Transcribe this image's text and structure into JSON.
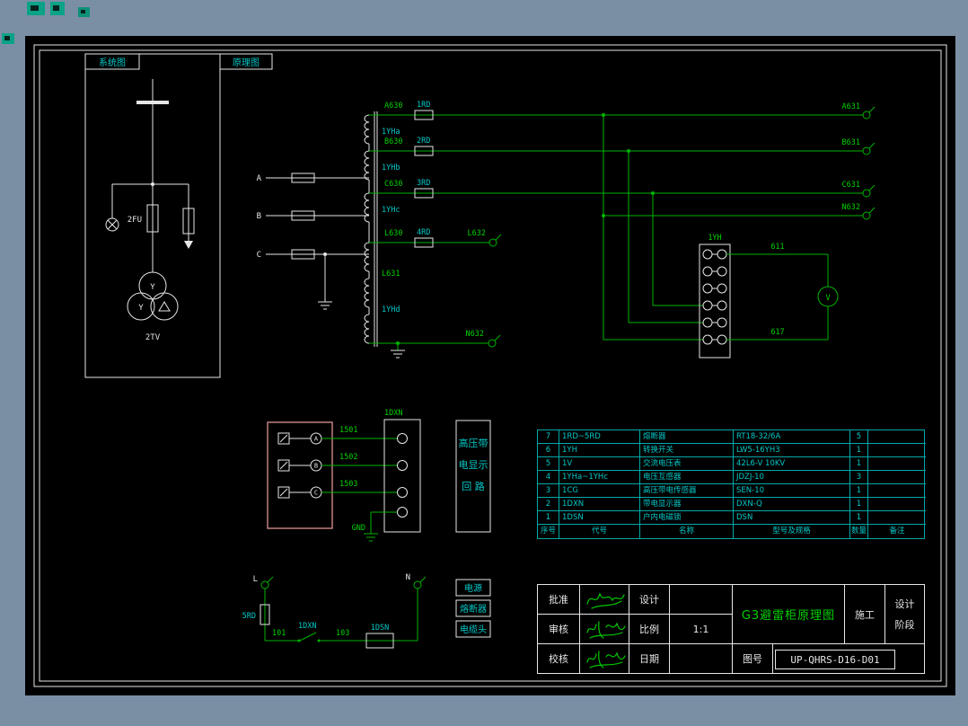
{
  "palette": {
    "background": "#7b8fa4",
    "paper": "#000000",
    "line_white": "#e6e6e6",
    "wire_green": "#00b400",
    "label_green": "#00d200",
    "label_cyan": "#00c8c8",
    "sensor_box_pink": "#c08080",
    "table_line_cyan": "#00a8a8"
  },
  "corner": {
    "system_label": "系统图",
    "schematic_label": "原理图"
  },
  "sys": {
    "fuse": "2FU",
    "tv": "2TV",
    "y1": "Y",
    "y2": "Y"
  },
  "sch": {
    "w_a630": "A630",
    "w_b630": "B630",
    "w_c630": "C630",
    "w_l630": "L630",
    "w_l631": "L631",
    "w_l632": "L632",
    "w_n632a": "N632",
    "w_n632b": "N632",
    "t_a631": "A631",
    "t_b631": "B631",
    "t_c631": "C631",
    "f1": "1RD",
    "f2": "2RD",
    "f3": "3RD",
    "f4": "4RD",
    "wind_a": "1YHa",
    "wind_b": "1YHb",
    "wind_c": "1YHc",
    "wind_d": "1YHd",
    "ph_a": "A",
    "ph_b": "B",
    "ph_c": "C",
    "switch": "1YH",
    "w611": "611",
    "w617": "617",
    "meter": "V"
  },
  "disp": {
    "w1": "1501",
    "w2": "1502",
    "w3": "1503",
    "s1": "A",
    "s2": "B",
    "s3": "C",
    "dxn": "1DXN",
    "gnd": "GND",
    "box_l1": "高压带",
    "box_l2": "电显示",
    "box_l3": "回 路"
  },
  "lock": {
    "l": "L",
    "n": "N",
    "fuse": "5RD",
    "w101": "101",
    "w103": "103",
    "dxn": "1DXN",
    "dsn": "1DSN"
  },
  "legend": {
    "i1": "电源",
    "i2": "熔断器",
    "i3": "电缆头"
  },
  "parts": {
    "headers": [
      "序号",
      "代号",
      "名称",
      "型号及规格",
      "数量",
      "备注"
    ],
    "rows": [
      [
        "7",
        "1RD~5RD",
        "熔断器",
        "RT18-32/6A",
        "5",
        ""
      ],
      [
        "6",
        "1YH",
        "转换开关",
        "LW5-16YH3",
        "1",
        ""
      ],
      [
        "5",
        "1V",
        "交流电压表",
        "42L6-V 10KV",
        "1",
        ""
      ],
      [
        "4",
        "1YHa~1YHc",
        "电压互感器",
        "JDZJ-10",
        "3",
        ""
      ],
      [
        "3",
        "1CG",
        "高压带电传感器",
        "SEN-10",
        "1",
        ""
      ],
      [
        "2",
        "1DXN",
        "带电显示器",
        "DXN-Q",
        "1",
        ""
      ],
      [
        "1",
        "1DSN",
        "户内电磁锁",
        "DSN",
        "1",
        ""
      ]
    ]
  },
  "tb": {
    "approve": "批准",
    "review": "审核",
    "check": "校核",
    "design": "设计",
    "scale": "比例",
    "scale_value": "1:1",
    "date": "日期",
    "title": "G3避雷柜原理图",
    "stage": "施工",
    "stage_col_l1": "设计",
    "stage_col_l2": "阶段",
    "no_label": "图号",
    "drawing_no": "UP-QHRS-D16-D01"
  }
}
